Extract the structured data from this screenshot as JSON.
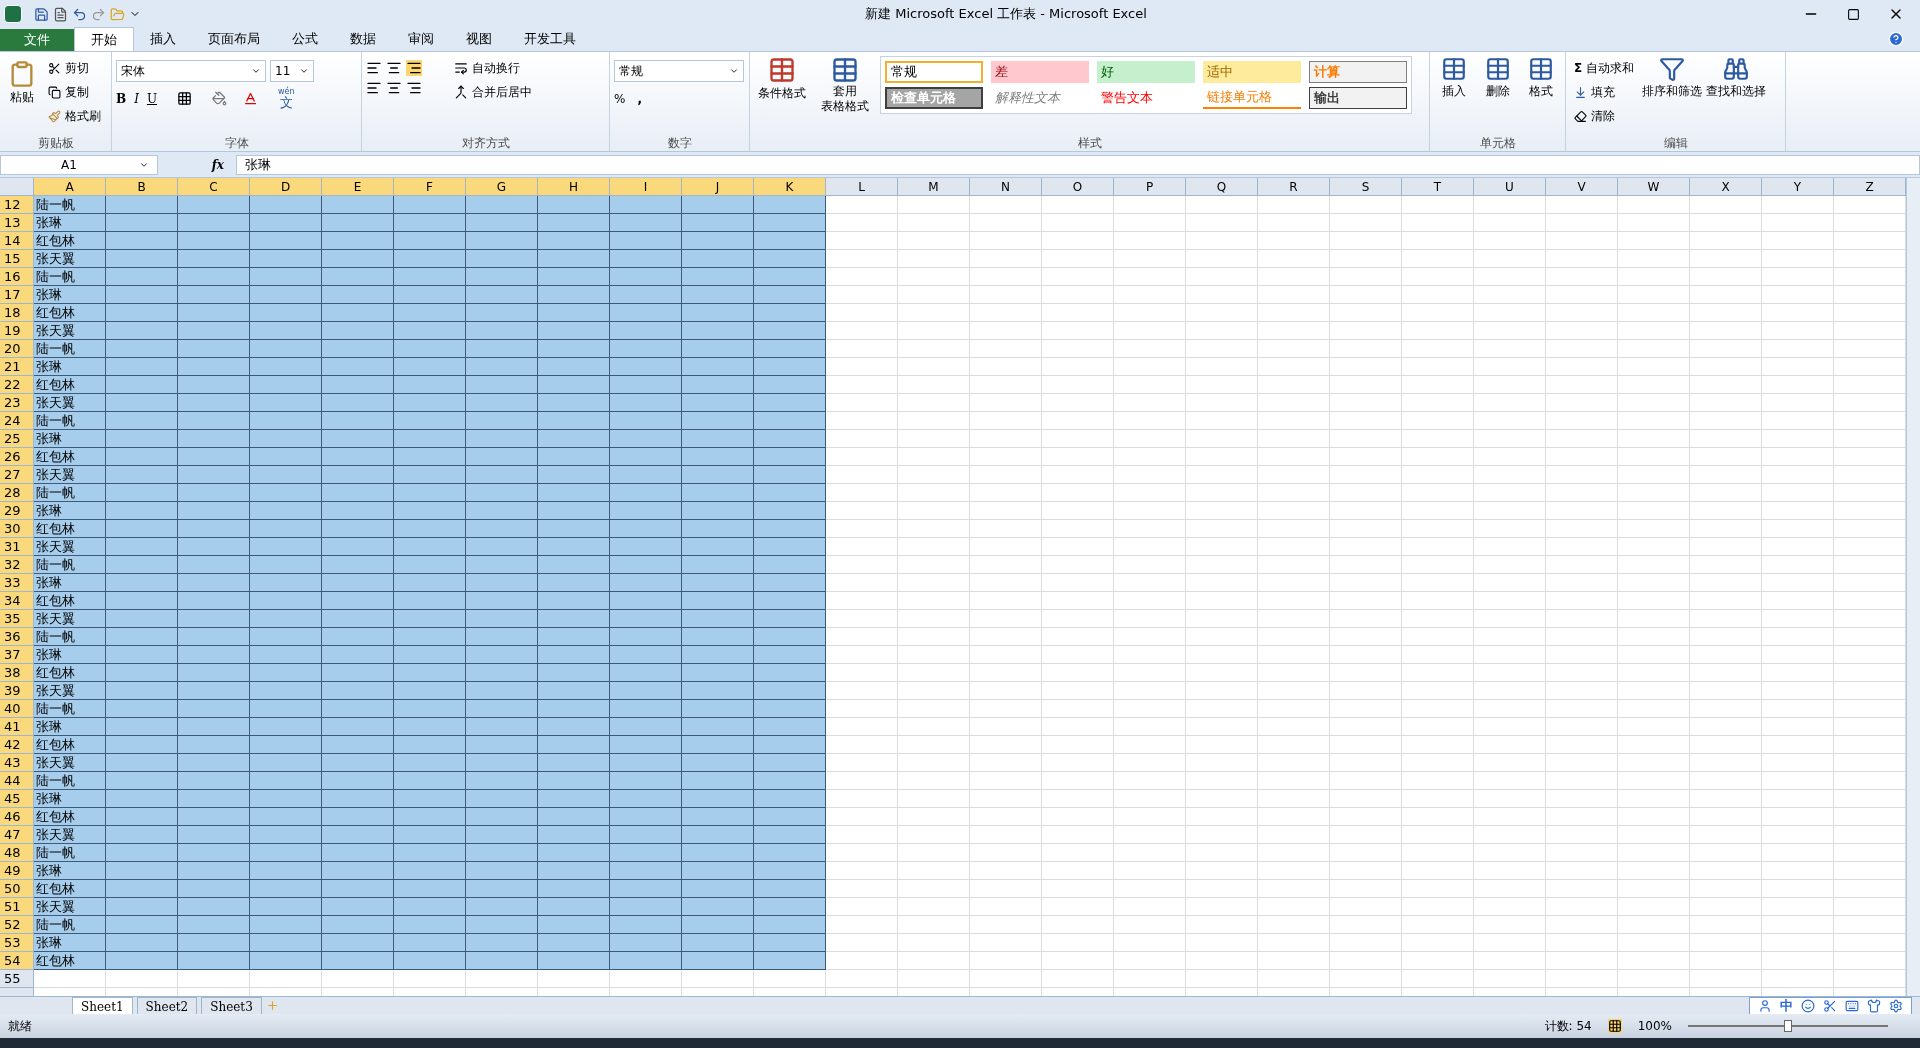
{
  "window": {
    "title": "新建 Microsoft Excel 工作表 - Microsoft Excel"
  },
  "tabs": [
    {
      "label": "文件",
      "kind": "file",
      "selected": false
    },
    {
      "label": "开始",
      "kind": "tab",
      "selected": true
    },
    {
      "label": "插入",
      "kind": "tab",
      "selected": false
    },
    {
      "label": "页面布局",
      "kind": "tab",
      "selected": false
    },
    {
      "label": "公式",
      "kind": "tab",
      "selected": false
    },
    {
      "label": "数据",
      "kind": "tab",
      "selected": false
    },
    {
      "label": "审阅",
      "kind": "tab",
      "selected": false
    },
    {
      "label": "视图",
      "kind": "tab",
      "selected": false
    },
    {
      "label": "开发工具",
      "kind": "tab",
      "selected": false
    }
  ],
  "clipboard": {
    "paste": "粘贴",
    "cut": "剪切",
    "copy": "复制",
    "painter": "格式刷",
    "label": "剪贴板"
  },
  "font": {
    "name": "宋体",
    "size": "11",
    "label": "字体",
    "bold": "B",
    "italic": "I",
    "underline": "U",
    "phonetic_top": "wén",
    "phonetic": "文"
  },
  "alignment": {
    "wrap": "自动换行",
    "merge": "合并后居中",
    "label": "对齐方式"
  },
  "number": {
    "format": "常规",
    "percent": "%",
    "comma": ",",
    "label": "数字"
  },
  "styles": {
    "conditional": "条件格式",
    "table_format_1": "套用",
    "table_format_2": "表格格式",
    "label": "样式",
    "cells": [
      {
        "label": "常规",
        "kind": "normal"
      },
      {
        "label": "差",
        "kind": "bad"
      },
      {
        "label": "好",
        "kind": "good"
      },
      {
        "label": "适中",
        "kind": "neutral"
      },
      {
        "label": "计算",
        "kind": "calc"
      },
      {
        "label": "检查单元格",
        "kind": "check"
      },
      {
        "label": "解释性文本",
        "kind": "explanatory"
      },
      {
        "label": "警告文本",
        "kind": "warning"
      },
      {
        "label": "链接单元格",
        "kind": "linked"
      },
      {
        "label": "输出",
        "kind": "output"
      }
    ]
  },
  "cells_group": {
    "insert": "插入",
    "delete": "删除",
    "format": "格式",
    "label": "单元格"
  },
  "editing": {
    "sigma": "Σ",
    "autosum": "自动求和",
    "fill": "填充",
    "clear": "清除",
    "sort": "排序和筛选",
    "find": "查找和选择",
    "label": "编辑"
  },
  "formula_bar": {
    "name_box": "A1",
    "fx": "fx",
    "value": "张琳"
  },
  "columns": [
    {
      "label": "A",
      "selected": true
    },
    {
      "label": "B",
      "selected": true
    },
    {
      "label": "C",
      "selected": true
    },
    {
      "label": "D",
      "selected": true
    },
    {
      "label": "E",
      "selected": true
    },
    {
      "label": "F",
      "selected": true
    },
    {
      "label": "G",
      "selected": true
    },
    {
      "label": "H",
      "selected": true
    },
    {
      "label": "I",
      "selected": true
    },
    {
      "label": "J",
      "selected": true
    },
    {
      "label": "K",
      "selected": true
    },
    {
      "label": "L",
      "selected": false
    },
    {
      "label": "M",
      "selected": false
    },
    {
      "label": "N",
      "selected": false
    },
    {
      "label": "O",
      "selected": false
    },
    {
      "label": "P",
      "selected": false
    },
    {
      "label": "Q",
      "selected": false
    },
    {
      "label": "R",
      "selected": false
    },
    {
      "label": "S",
      "selected": false
    },
    {
      "label": "T",
      "selected": false
    },
    {
      "label": "U",
      "selected": false
    },
    {
      "label": "V",
      "selected": false
    },
    {
      "label": "W",
      "selected": false
    },
    {
      "label": "X",
      "selected": false
    },
    {
      "label": "Y",
      "selected": false
    },
    {
      "label": "Z",
      "selected": false
    }
  ],
  "rows": [
    {
      "number": "12",
      "a": "陆一帆",
      "selected": true
    },
    {
      "number": "13",
      "a": "张琳",
      "selected": true
    },
    {
      "number": "14",
      "a": "红包林",
      "selected": true
    },
    {
      "number": "15",
      "a": "张天翼",
      "selected": true
    },
    {
      "number": "16",
      "a": "陆一帆",
      "selected": true
    },
    {
      "number": "17",
      "a": "张琳",
      "selected": true
    },
    {
      "number": "18",
      "a": "红包林",
      "selected": true
    },
    {
      "number": "19",
      "a": "张天翼",
      "selected": true
    },
    {
      "number": "20",
      "a": "陆一帆",
      "selected": true
    },
    {
      "number": "21",
      "a": "张琳",
      "selected": true
    },
    {
      "number": "22",
      "a": "红包林",
      "selected": true
    },
    {
      "number": "23",
      "a": "张天翼",
      "selected": true
    },
    {
      "number": "24",
      "a": "陆一帆",
      "selected": true
    },
    {
      "number": "25",
      "a": "张琳",
      "selected": true
    },
    {
      "number": "26",
      "a": "红包林",
      "selected": true
    },
    {
      "number": "27",
      "a": "张天翼",
      "selected": true
    },
    {
      "number": "28",
      "a": "陆一帆",
      "selected": true
    },
    {
      "number": "29",
      "a": "张琳",
      "selected": true
    },
    {
      "number": "30",
      "a": "红包林",
      "selected": true
    },
    {
      "number": "31",
      "a": "张天翼",
      "selected": true
    },
    {
      "number": "32",
      "a": "陆一帆",
      "selected": true
    },
    {
      "number": "33",
      "a": "张琳",
      "selected": true
    },
    {
      "number": "34",
      "a": "红包林",
      "selected": true
    },
    {
      "number": "35",
      "a": "张天翼",
      "selected": true
    },
    {
      "number": "36",
      "a": "陆一帆",
      "selected": true
    },
    {
      "number": "37",
      "a": "张琳",
      "selected": true
    },
    {
      "number": "38",
      "a": "红包林",
      "selected": true
    },
    {
      "number": "39",
      "a": "张天翼",
      "selected": true
    },
    {
      "number": "40",
      "a": "陆一帆",
      "selected": true
    },
    {
      "number": "41",
      "a": "张琳",
      "selected": true
    },
    {
      "number": "42",
      "a": "红包林",
      "selected": true
    },
    {
      "number": "43",
      "a": "张天翼",
      "selected": true
    },
    {
      "number": "44",
      "a": "陆一帆",
      "selected": true
    },
    {
      "number": "45",
      "a": "张琳",
      "selected": true
    },
    {
      "number": "46",
      "a": "红包林",
      "selected": true
    },
    {
      "number": "47",
      "a": "张天翼",
      "selected": true
    },
    {
      "number": "48",
      "a": "陆一帆",
      "selected": true
    },
    {
      "number": "49",
      "a": "张琳",
      "selected": true
    },
    {
      "number": "50",
      "a": "红包林",
      "selected": true
    },
    {
      "number": "51",
      "a": "张天翼",
      "selected": true
    },
    {
      "number": "52",
      "a": "陆一帆",
      "selected": true
    },
    {
      "number": "53",
      "a": "张琳",
      "selected": true
    },
    {
      "number": "54",
      "a": "红包林",
      "selected": true
    },
    {
      "number": "55",
      "selected": false
    }
  ],
  "sheets": [
    {
      "label": "Sheet1",
      "selected": true
    },
    {
      "label": "Sheet2",
      "selected": false
    },
    {
      "label": "Sheet3",
      "selected": false
    }
  ],
  "status_bar": {
    "ready": "就绪",
    "count": "计数: 54",
    "zoom": "100%",
    "zoom_slider": {
      "level": 0.5
    }
  },
  "ime": {
    "label": "中"
  }
}
